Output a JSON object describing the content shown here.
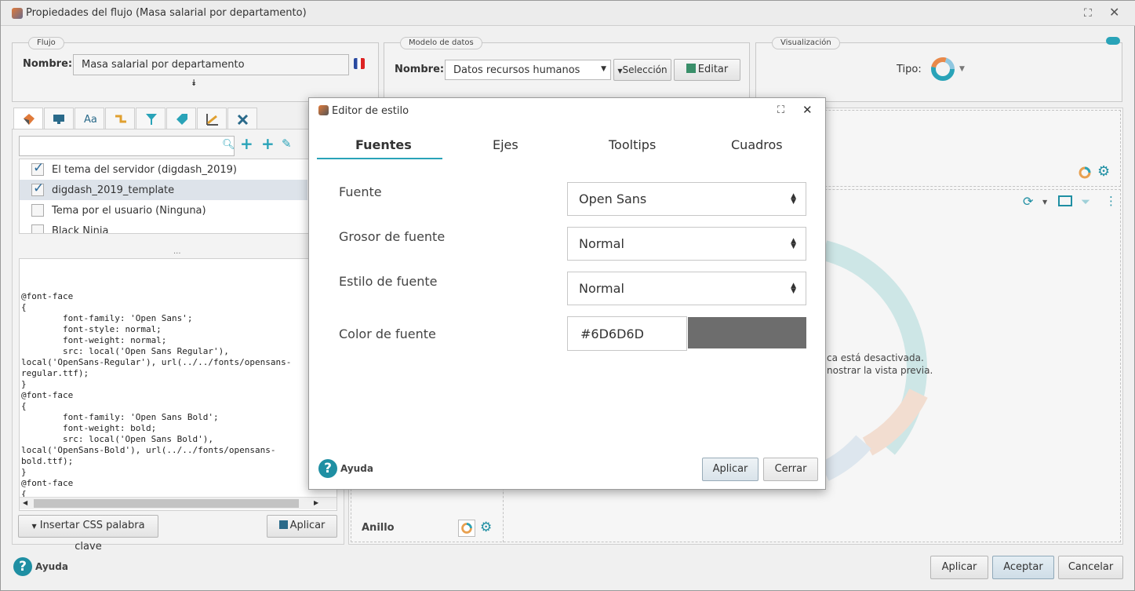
{
  "window": {
    "title": "Propiedades del flujo (Masa salarial por departamento)"
  },
  "flujo": {
    "legend": "Flujo",
    "name_label": "Nombre:",
    "name_value": "Masa salarial por departamento"
  },
  "modelo": {
    "legend": "Modelo de datos",
    "name_label": "Nombre:",
    "name_value": "Datos recursos humanos",
    "select_button": "Selección",
    "edit_button": "Editar"
  },
  "visual": {
    "legend": "Visualización",
    "type_label": "Tipo:"
  },
  "styles": {
    "items": [
      {
        "label": "El tema del servidor (digdash_2019)",
        "checked": true
      },
      {
        "label": "digdash_2019_template",
        "checked": true
      },
      {
        "label": "Tema por el usuario (Ninguna)",
        "checked": false
      },
      {
        "label": "Black Ninja",
        "checked": false
      }
    ],
    "divider": "...",
    "css": "@font-face\n{\n        font-family: 'Open Sans';\n        font-style: normal;\n        font-weight: normal;\n        src: local('Open Sans Regular'),\nlocal('OpenSans-Regular'), url(../../fonts/opensans-\nregular.ttf);\n}\n@font-face\n{\n        font-family: 'Open Sans Bold';\n        font-weight: bold;\n        src: local('Open Sans Bold'),\nlocal('OpenSans-Bold'), url(../../fonts/opensans-\nbold.ttf);\n}\n@font-face\n{",
    "insert_button": "Insertar CSS palabra clave",
    "apply_button": "Aplicar"
  },
  "preview": {
    "msg1": "ca está desactivada.",
    "msg2": "nostrar la vista previa.",
    "chart_label": "Anillo"
  },
  "footer": {
    "help": "Ayuda",
    "apply": "Aplicar",
    "accept": "Aceptar",
    "cancel": "Cancelar"
  },
  "modal": {
    "title": "Editor de estilo",
    "tabs": [
      "Fuentes",
      "Ejes",
      "Tooltips",
      "Cuadros"
    ],
    "active_tab": "Fuentes",
    "font_label": "Fuente",
    "font_value": "Open Sans",
    "weight_label": "Grosor de fuente",
    "weight_value": "Normal",
    "style_label": "Estilo de fuente",
    "style_value": "Normal",
    "color_label": "Color de fuente",
    "color_value": "#6D6D6D",
    "help": "Ayuda",
    "apply": "Aplicar",
    "close": "Cerrar"
  },
  "colors": {
    "accent": "#29a3b8",
    "swatch": "#6D6D6D"
  }
}
